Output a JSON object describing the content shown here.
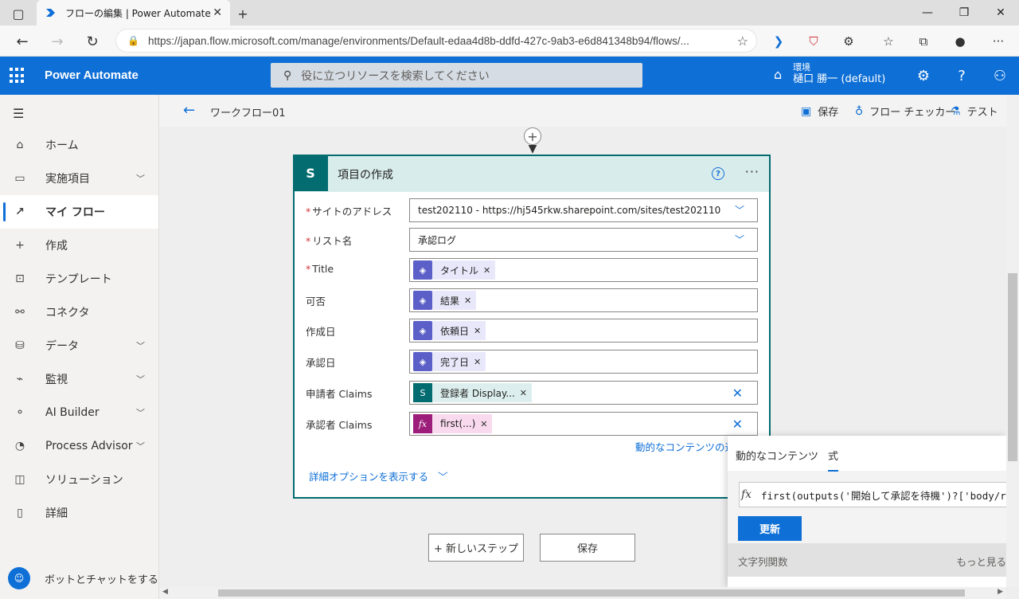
{
  "browser": {
    "tab_title": "フローの編集 | Power Automate",
    "url": "https://japan.flow.microsoft.com/manage/environments/Default-edaa4d8b-ddfd-427c-9ab3-e6d841348b94/flows/..."
  },
  "header": {
    "app_title": "Power Automate",
    "search_placeholder": "役に立つリソースを検索してください",
    "env_label": "環境",
    "env_name": "樋口 勝一 (default)"
  },
  "sidebar": {
    "items": [
      {
        "label": "ホーム"
      },
      {
        "label": "実施項目"
      },
      {
        "label": "マイ フロー"
      },
      {
        "label": "作成"
      },
      {
        "label": "テンプレート"
      },
      {
        "label": "コネクタ"
      },
      {
        "label": "データ"
      },
      {
        "label": "監視"
      },
      {
        "label": "AI Builder"
      },
      {
        "label": "Process Advisor"
      },
      {
        "label": "ソリューション"
      },
      {
        "label": "詳細"
      }
    ],
    "bot_label": "ボットとチャットをする"
  },
  "commandbar": {
    "flow_name": "ワークフロー01",
    "save": "保存",
    "checker": "フロー チェッカー",
    "test": "テスト"
  },
  "card": {
    "title": "項目の作成",
    "fields": [
      {
        "label": "サイトのアドレス",
        "required": "*",
        "value": "test202110 - https://hj545rkw.sharepoint.com/sites/test202110"
      },
      {
        "label": "リスト名",
        "required": "*",
        "value": "承認ログ"
      },
      {
        "label": "Title",
        "required": "*",
        "token": "タイトル"
      },
      {
        "label": "可否",
        "token": "結果"
      },
      {
        "label": "作成日",
        "token": "依頼日"
      },
      {
        "label": "承認日",
        "token": "完了日"
      },
      {
        "label": "申請者 Claims",
        "token": "登録者 Display..."
      },
      {
        "label": "承認者 Claims",
        "token": "first(...)"
      }
    ],
    "dynamic_link": "動的なコンテンツの追",
    "advanced_link": "詳細オプションを表示する"
  },
  "footer_buttons": {
    "new_step": "+ 新しいステップ",
    "save": "保存"
  },
  "flyout": {
    "tab_dynamic": "動的なコンテンツ",
    "tab_expression": "式",
    "expression": "first(outputs('開始して承認を待機')?['body/responses'])?['responder/claims']",
    "update": "更新",
    "section": "文字列関数",
    "see_more": "もっと見る"
  },
  "colors": {
    "brand": "#0e6fd6",
    "sharepoint": "#036c70",
    "approval": "#5b5fc7",
    "expression": "#9c1d7a"
  }
}
